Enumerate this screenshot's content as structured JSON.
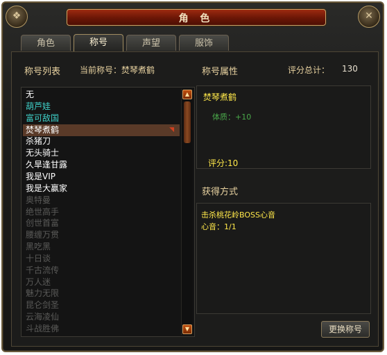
{
  "window": {
    "title": "角 色"
  },
  "tabs": [
    "角色",
    "称号",
    "声望",
    "服饰"
  ],
  "active_tab": 1,
  "left": {
    "header_title": "称号列表",
    "current_title_label": "当前称号：焚琴煮鹤"
  },
  "title_list": [
    {
      "text": "无",
      "color": "#ffffff"
    },
    {
      "text": "葫芦娃",
      "color": "#3fd0c8"
    },
    {
      "text": "富可敌国",
      "color": "#3fd0c8"
    },
    {
      "text": "焚琴煮鹤",
      "color": "#ffffff",
      "selected": true
    },
    {
      "text": "杀猪刀",
      "color": "#ffffff"
    },
    {
      "text": "无头骑士",
      "color": "#ffffff"
    },
    {
      "text": "久旱逢甘露",
      "color": "#ffffff"
    },
    {
      "text": "我是VIP",
      "color": "#ffffff"
    },
    {
      "text": "我是大赢家",
      "color": "#ffffff"
    },
    {
      "text": "奥特曼",
      "color": "#5a5a58"
    },
    {
      "text": "绝世高手",
      "color": "#5a5a58"
    },
    {
      "text": "创世首富",
      "color": "#5a5a58"
    },
    {
      "text": "腰缠万贯",
      "color": "#5a5a58"
    },
    {
      "text": "黑吃黑",
      "color": "#5a5a58"
    },
    {
      "text": "十日谈",
      "color": "#5a5a58"
    },
    {
      "text": "千古流传",
      "color": "#5a5a58"
    },
    {
      "text": "万人迷",
      "color": "#5a5a58"
    },
    {
      "text": "魅力无限",
      "color": "#5a5a58"
    },
    {
      "text": "昆仑剑圣",
      "color": "#5a5a58"
    },
    {
      "text": "云海凌仙",
      "color": "#5a5a58"
    },
    {
      "text": "斗战胜佛",
      "color": "#5a5a58"
    }
  ],
  "right": {
    "attr_header": "称号属性",
    "score_total_label": "评分总计：",
    "score_total_value": "130",
    "selected_title_name": "焚琴煮鹤",
    "attribute": "体质：+10",
    "score": "评分:10",
    "obtain_header": "获得方式",
    "obtain_line1": "击杀桃花岭BOSS心音",
    "obtain_line2": "心音：1/1",
    "change_button": "更换称号"
  },
  "colors": {
    "accent_gold": "#e8d2a0",
    "teal": "#3fd0c8",
    "green": "#4aa84a",
    "yellow": "#ffe84a"
  }
}
